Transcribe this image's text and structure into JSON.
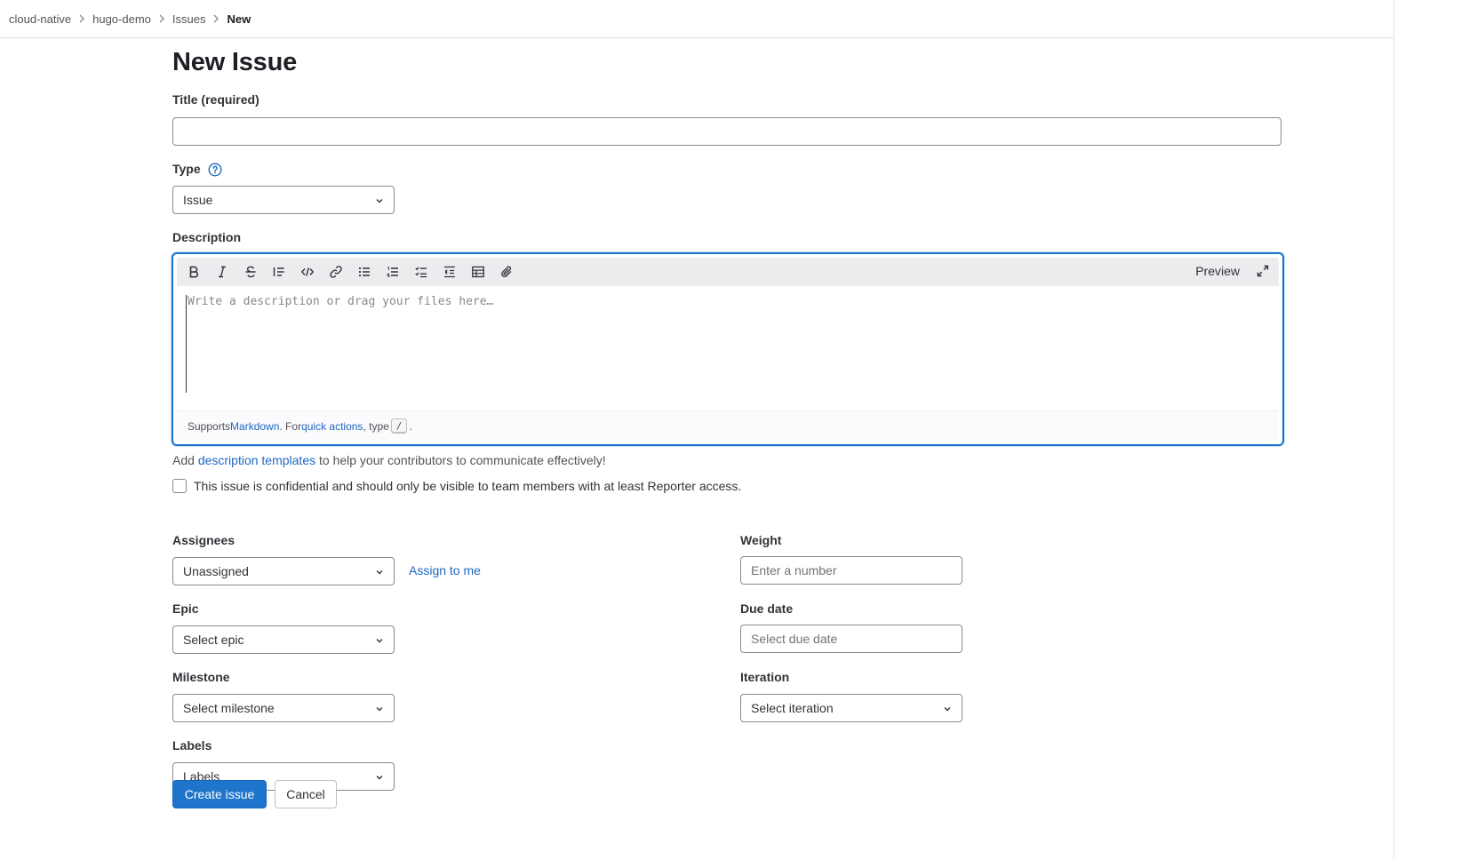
{
  "breadcrumb": [
    "cloud-native",
    "hugo-demo",
    "Issues",
    "New"
  ],
  "page": {
    "title": "New Issue"
  },
  "fields": {
    "title_label": "Title (required)",
    "title_value": "",
    "type_label": "Type",
    "type_value": "Issue",
    "description_label": "Description"
  },
  "editor": {
    "toolbar_icons": [
      "bold-icon",
      "italic-icon",
      "strikethrough-icon",
      "quote-icon",
      "code-icon",
      "link-icon",
      "bulleted-list-icon",
      "numbered-list-icon",
      "task-list-icon",
      "collapsible-section-icon",
      "table-icon",
      "attach-file-icon"
    ],
    "preview_label": "Preview",
    "placeholder": "Write a description or drag your files here…",
    "footer": {
      "supports": "Supports ",
      "markdown_link": "Markdown",
      "for_text": ". For ",
      "quick_actions_link": "quick actions",
      "type_text": ", type ",
      "kbd": "/",
      "end": "."
    }
  },
  "help": {
    "add": "Add ",
    "templates_link": "description templates",
    "rest": " to help your contributors to communicate effectively!"
  },
  "confidential": {
    "label": "This issue is confidential and should only be visible to team members with at least Reporter access.",
    "checked": false
  },
  "sidebar_left": {
    "assignees_label": "Assignees",
    "assignees_value": "Unassigned",
    "assign_to_me": "Assign to me",
    "epic_label": "Epic",
    "epic_value": "Select epic",
    "milestone_label": "Milestone",
    "milestone_value": "Select milestone",
    "labels_label": "Labels",
    "labels_value": "Labels"
  },
  "sidebar_right": {
    "weight_label": "Weight",
    "weight_placeholder": "Enter a number",
    "due_label": "Due date",
    "due_placeholder": "Select due date",
    "iteration_label": "Iteration",
    "iteration_value": "Select iteration"
  },
  "actions": {
    "create": "Create issue",
    "cancel": "Cancel"
  },
  "colors": {
    "primary": "#1f75cb",
    "link": "#1f69c0",
    "border": "#89888d"
  }
}
